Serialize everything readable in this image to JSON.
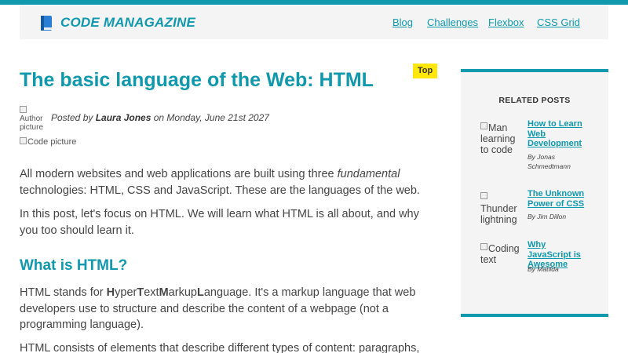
{
  "colors": {
    "accent": "#1098ad",
    "badge": "#ffe70a",
    "header_bg": "#f4f4f4"
  },
  "header": {
    "logo_icon": "book-icon",
    "logo_text": "CODE MANAGAZINE",
    "nav": [
      "Blog",
      "Challenges",
      "Flexbox",
      "CSS Grid"
    ]
  },
  "article": {
    "title": "The basic language of the Web: HTML",
    "badge": "Top",
    "author_img_alt": "Author picture",
    "posted_prefix": "Posted by ",
    "author": "Laura Jones",
    "posted_on": " on Monday, June 21st 2027",
    "code_img_alt": "Code picture",
    "p1_a": "All modern websites and web applications are built using three ",
    "p1_em": "fundamental",
    "p1_b": " technologies: HTML, CSS and JavaScript. These are the languages of the web.",
    "p2": "In this post, let's focus on HTML. We will learn what HTML is all about, and why you too should learn it.",
    "h2": "What is HTML?",
    "p3_parts": [
      "HTML stands for ",
      "H",
      "yper",
      "T",
      "ext",
      "M",
      "arkup",
      "L",
      "anguage",
      ". It's a markup language that web developers use to structure and describe the content of a webpage (not a programming language)."
    ],
    "p4": "HTML consists of elements that describe different types of content: paragraphs,"
  },
  "aside": {
    "title": "RELATED POSTS",
    "posts": [
      {
        "img_alt": "Man learning to code",
        "title": "How to Learn Web Development",
        "author": "By Jonas Schmedtmann"
      },
      {
        "img_alt": "Thunder lightning",
        "title": "The Unknown Power of CSS",
        "author": "By Jim Dillon"
      },
      {
        "img_alt": "Coding text",
        "title": "Why JavaScript is Awesome",
        "author": "By Matilda"
      }
    ]
  }
}
